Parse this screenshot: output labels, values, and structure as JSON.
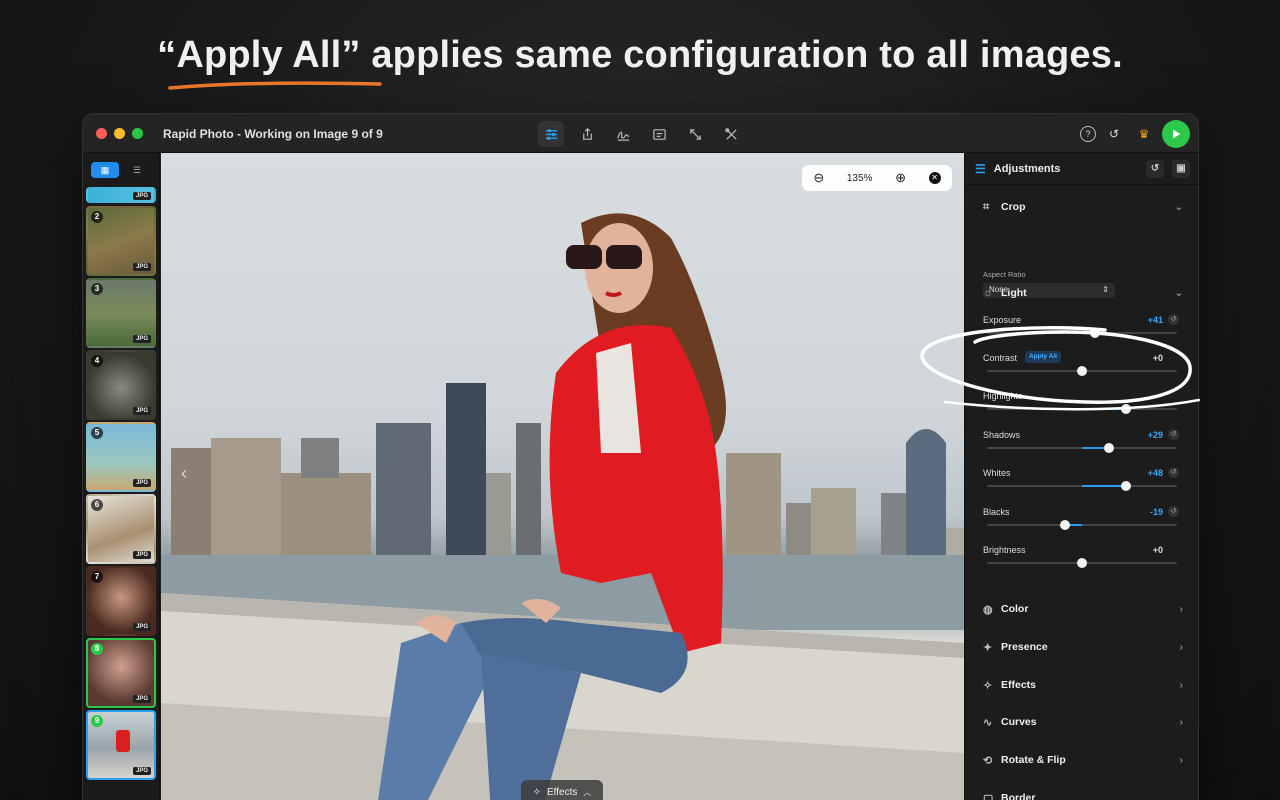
{
  "headline": {
    "accent": "“Apply All”",
    "rest": " applies same configuration to all images."
  },
  "window": {
    "title": "Rapid Photo - Working on Image 9 of 9"
  },
  "toolbar": {
    "icons": [
      "sliders-icon",
      "share-icon",
      "signature-icon",
      "text-box-icon",
      "resize-icon",
      "tools-icon"
    ]
  },
  "sidebar": {
    "view_modes": [
      "grid-icon",
      "list-icon"
    ],
    "thumbs": [
      {
        "num": "",
        "fmt": "JPG"
      },
      {
        "num": "2",
        "fmt": "JPG"
      },
      {
        "num": "3",
        "fmt": "JPG"
      },
      {
        "num": "4",
        "fmt": "JPG"
      },
      {
        "num": "5",
        "fmt": "JPG"
      },
      {
        "num": "6",
        "fmt": "JPG"
      },
      {
        "num": "7",
        "fmt": "JPG"
      },
      {
        "num": "8",
        "fmt": "JPG"
      },
      {
        "num": "9",
        "fmt": "JPG"
      }
    ]
  },
  "canvas": {
    "zoom": "135%",
    "effects_label": "Effects"
  },
  "panel": {
    "title": "Adjustments",
    "crop": {
      "label": "Crop",
      "aspect_label": "Aspect Ratio",
      "aspect_value": "None"
    },
    "light": {
      "label": "Light"
    },
    "apply_all_label": "Apply All",
    "sliders": [
      {
        "label": "Exposure",
        "value": "+41",
        "level": 0.57
      },
      {
        "label": "Contrast",
        "value": "+0",
        "level": 0.5
      },
      {
        "label": "Highlights",
        "value": "",
        "level": 0.73
      },
      {
        "label": "Shadows",
        "value": "+29",
        "level": 0.64
      },
      {
        "label": "Whites",
        "value": "+48",
        "level": 0.73
      },
      {
        "label": "Blacks",
        "value": "-19",
        "level": 0.41
      },
      {
        "label": "Brightness",
        "value": "+0",
        "level": 0.5
      }
    ],
    "sections": [
      "Color",
      "Presence",
      "Effects",
      "Curves",
      "Rotate & Flip",
      "Border"
    ]
  }
}
